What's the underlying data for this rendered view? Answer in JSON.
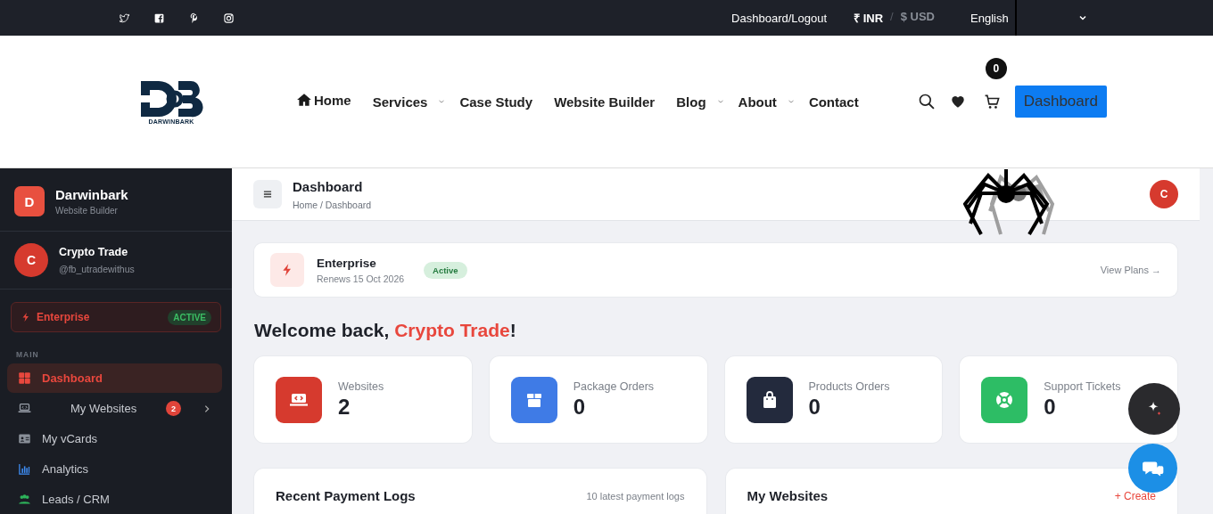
{
  "topbar": {
    "account_link": "Dashboard/Logout",
    "currencies": [
      {
        "label": "₹ INR",
        "selected": true
      },
      {
        "label": "$ USD",
        "selected": false
      }
    ],
    "currency_separator": "/",
    "language": "English"
  },
  "header": {
    "logo_text": "DARWINBARK",
    "nav": [
      {
        "label": "Home",
        "kind": "home",
        "dropdown": false
      },
      {
        "label": "Services",
        "kind": "link",
        "dropdown": true
      },
      {
        "label": "Case Study",
        "kind": "link",
        "dropdown": false
      },
      {
        "label": "Website Builder",
        "kind": "link",
        "dropdown": false
      },
      {
        "label": "Blog",
        "kind": "link",
        "dropdown": true
      },
      {
        "label": "About",
        "kind": "link",
        "dropdown": true
      },
      {
        "label": "Contact",
        "kind": "link",
        "dropdown": false
      }
    ],
    "cart_count": "0",
    "dashboard_button": "Dashboard"
  },
  "sidebar": {
    "brand": {
      "initial": "D",
      "name": "Darwinbark",
      "subtitle": "Website Builder"
    },
    "user": {
      "initial": "C",
      "name": "Crypto Trade",
      "handle": "@fb_utradewithus"
    },
    "plan": {
      "name": "Enterprise",
      "status": "ACTIVE"
    },
    "section": "MAIN",
    "items": [
      {
        "label": "Dashboard",
        "kind": "grid",
        "selected": true
      },
      {
        "label": "My Websites",
        "kind": "laptop",
        "selected": false,
        "badge": "2",
        "expandable": true
      },
      {
        "label": "My vCards",
        "kind": "vcard",
        "selected": false
      },
      {
        "label": "Analytics",
        "kind": "chart",
        "selected": false
      },
      {
        "label": "Leads / CRM",
        "kind": "people",
        "selected": false
      }
    ]
  },
  "main": {
    "title": "Dashboard",
    "breadcrumb": "Home / Dashboard",
    "avatar": "C",
    "plan_card": {
      "name": "Enterprise",
      "renews": "Renews 15 Oct 2026",
      "status": "Active",
      "link": "View Plans →"
    },
    "welcome": {
      "before": "Welcome back, ",
      "name": "Crypto Trade",
      "after": "!"
    },
    "stats": [
      {
        "label": "Websites",
        "value": "2",
        "kind": "laptop",
        "color": "#d63a2e"
      },
      {
        "label": "Package Orders",
        "value": "0",
        "kind": "box",
        "color": "#3f7be6"
      },
      {
        "label": "Products Orders",
        "value": "0",
        "kind": "bag",
        "color": "#232a3d"
      },
      {
        "label": "Support Tickets",
        "value": "0",
        "kind": "lifebuoy",
        "color": "#2dbd65"
      }
    ],
    "panels": [
      {
        "title": "Recent Payment Logs",
        "note": "10 latest payment logs"
      },
      {
        "title": "My Websites",
        "action": "+ Create"
      }
    ]
  }
}
